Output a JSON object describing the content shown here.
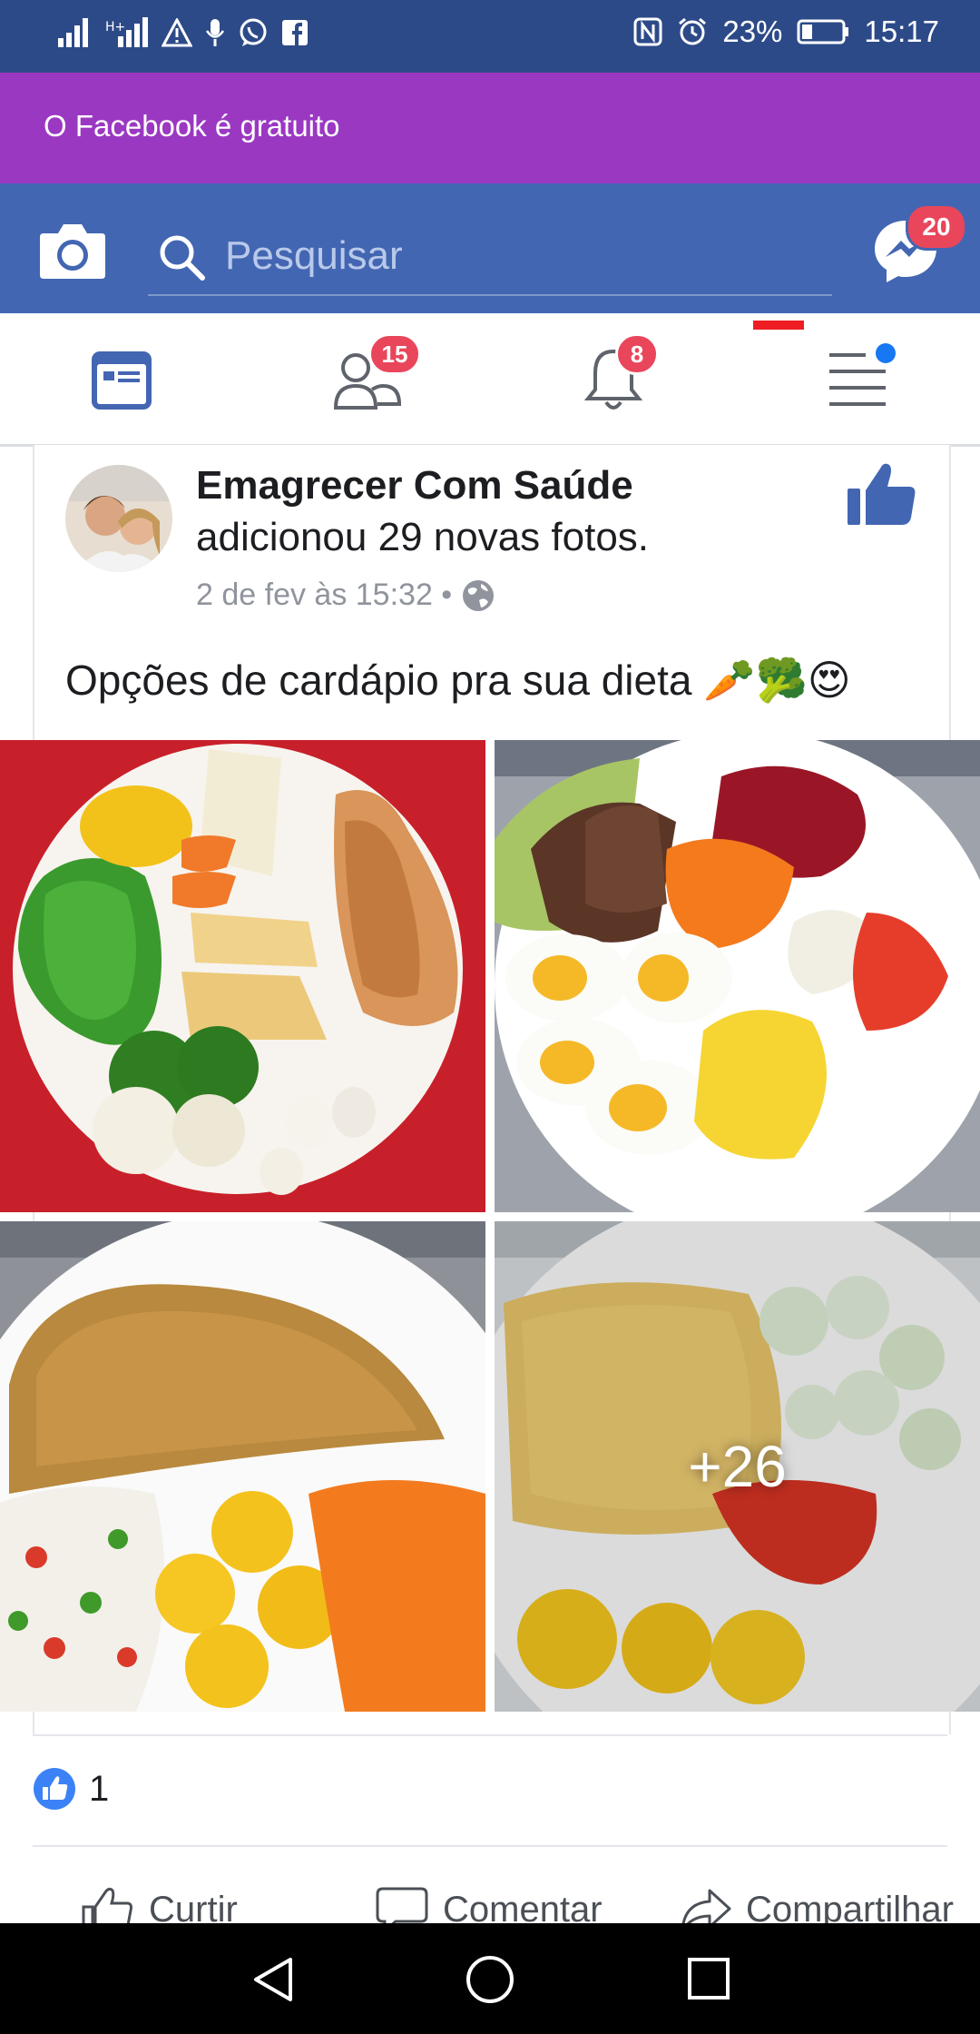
{
  "status_bar": {
    "battery": "23%",
    "time": "15:17"
  },
  "banner": {
    "text": "O Facebook é gratuito"
  },
  "header": {
    "search_placeholder": "Pesquisar",
    "messenger_badge": "20"
  },
  "tabs": [
    {
      "name": "news-feed",
      "badge": ""
    },
    {
      "name": "friends",
      "badge": "15"
    },
    {
      "name": "notifications",
      "badge": "8"
    },
    {
      "name": "menu",
      "badge": ""
    }
  ],
  "post": {
    "page_name": "Emagrecer Com Saúde",
    "action": "adicionou 29 novas fotos.",
    "timestamp": "2 de fev às 15:32 •",
    "text": "Opções de cardápio pra sua dieta 🥕🥦😍",
    "more_photos": "+26",
    "reaction_count": "1"
  },
  "actions": {
    "like": "Curtir",
    "comment": "Comentar",
    "share": "Compartilhar"
  },
  "colors": {
    "status_bar": "#2d4a88",
    "banner": "#9b38c2",
    "header": "#4366b2",
    "badge": "#e9465b",
    "brand": "#4366b2"
  }
}
